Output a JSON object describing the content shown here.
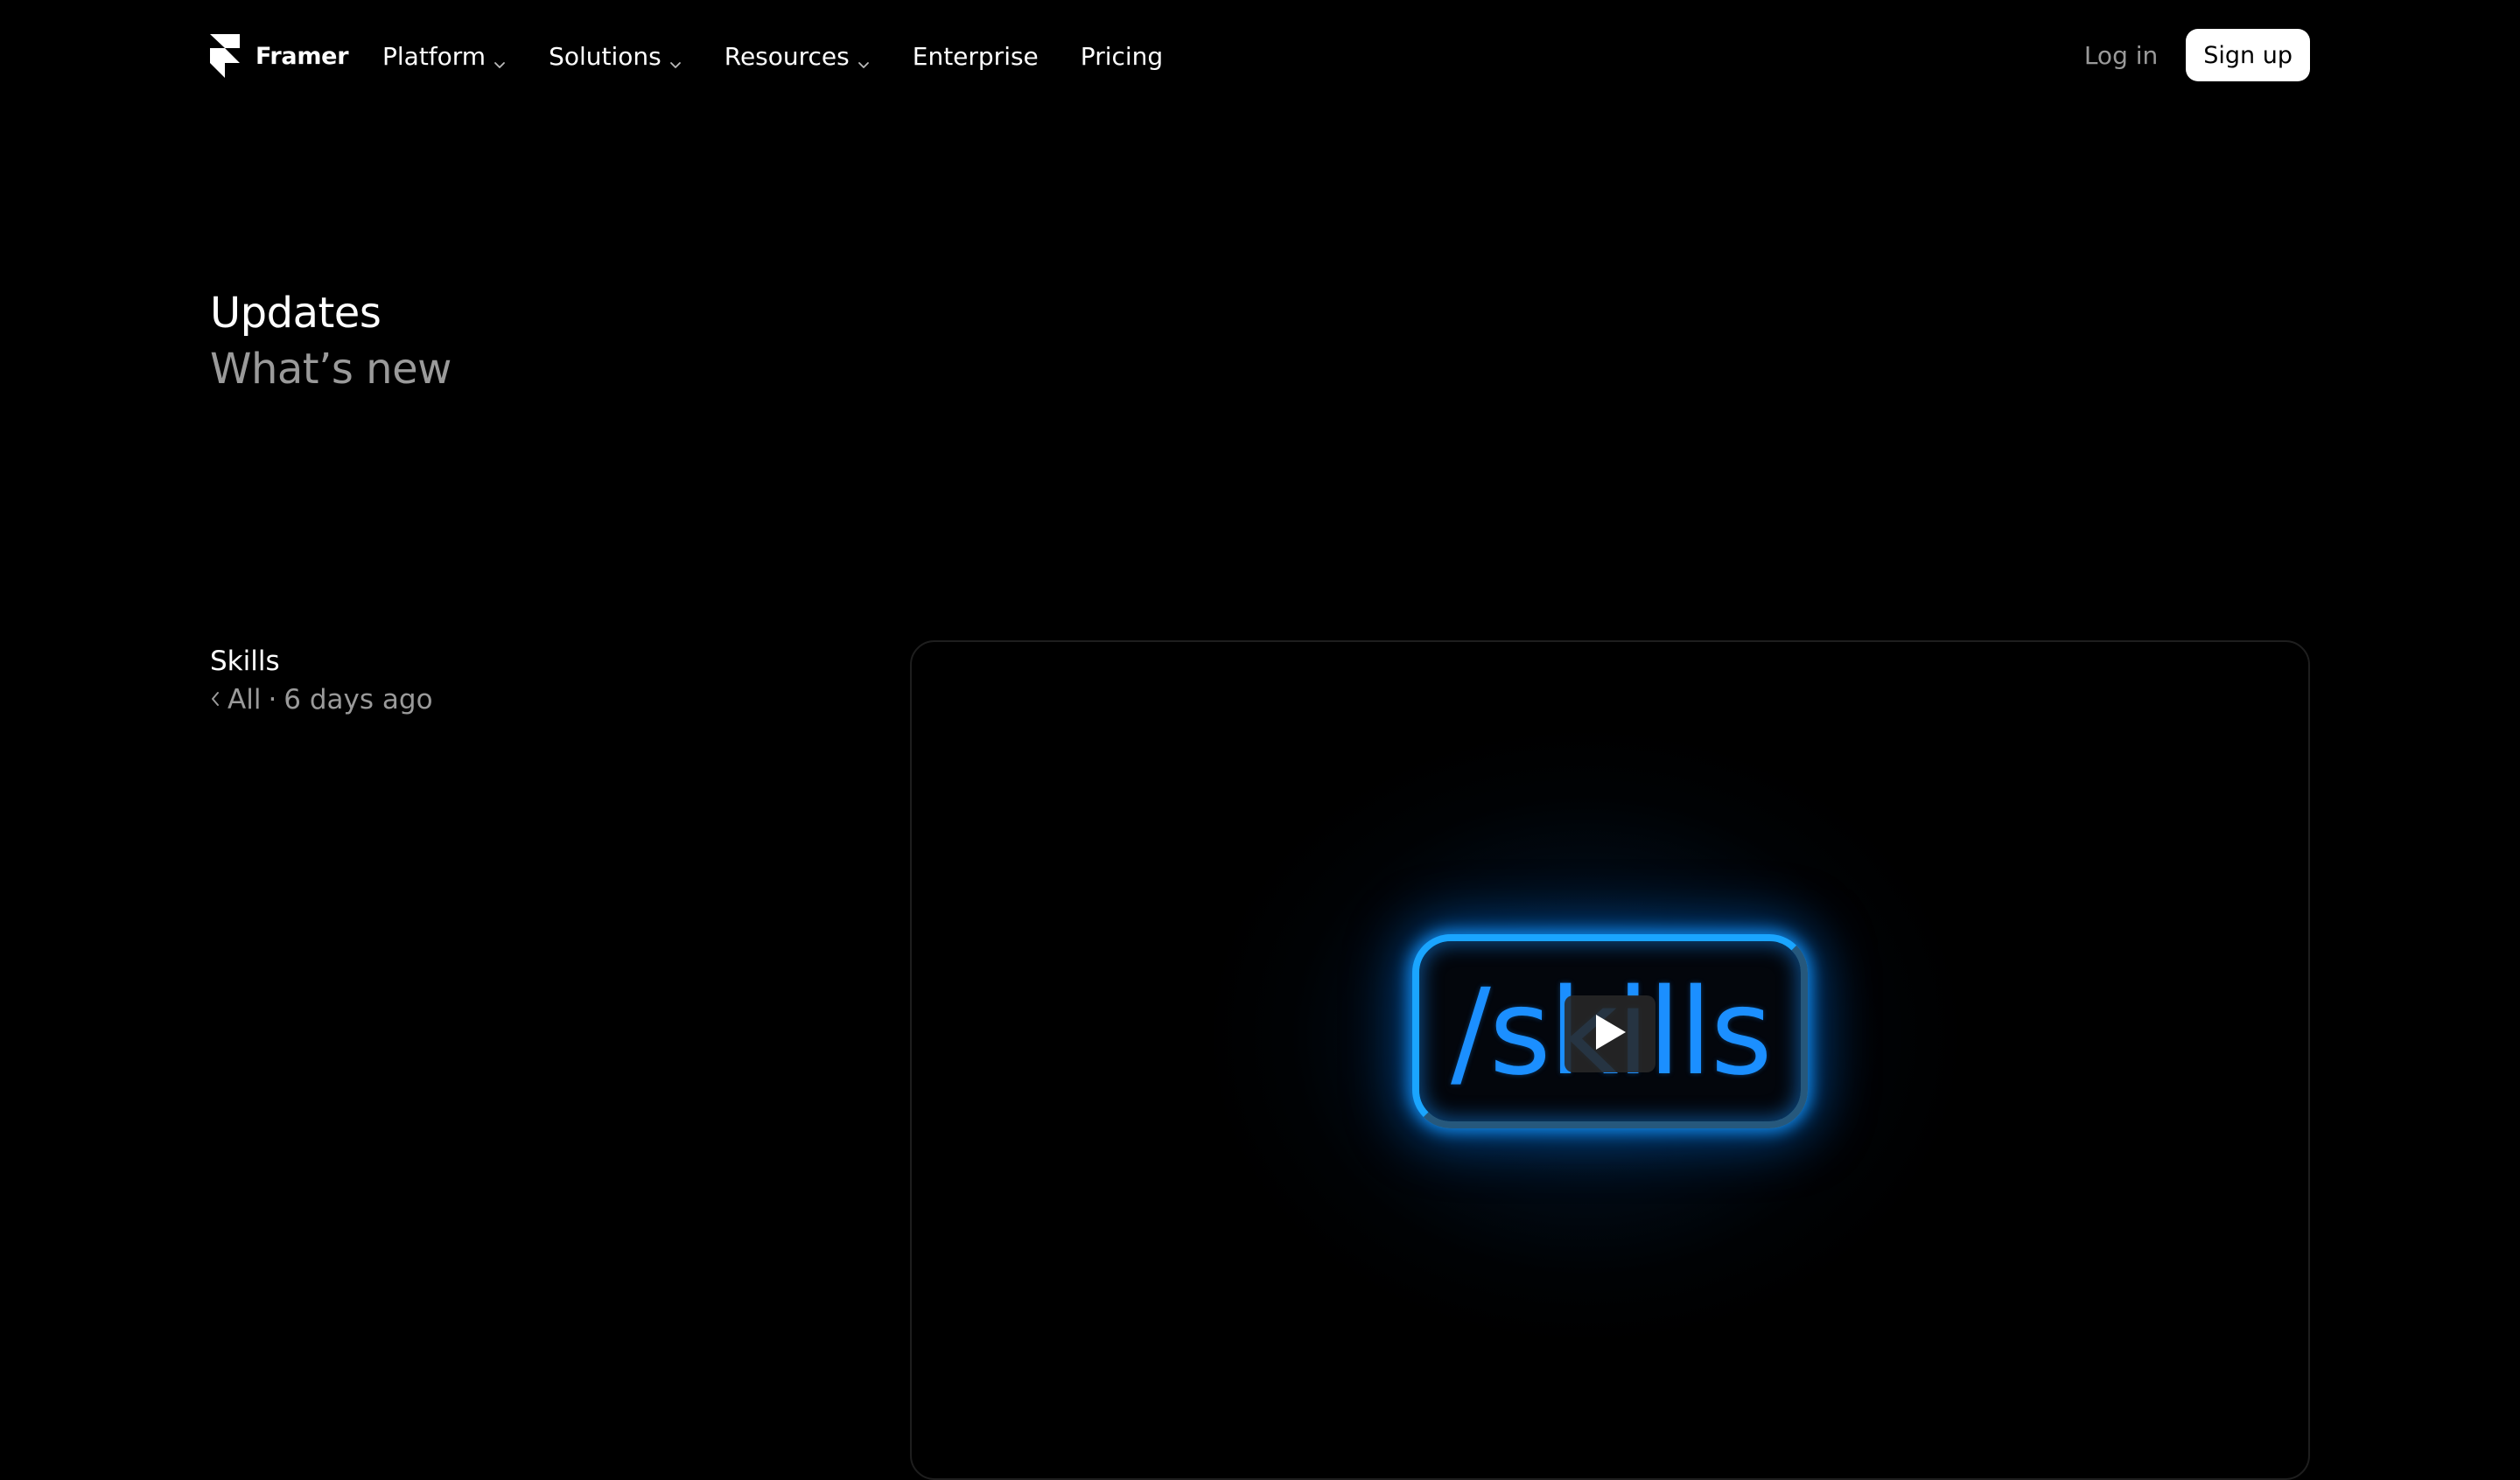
{
  "nav": {
    "brand": "Framer",
    "links": [
      {
        "label": "Platform",
        "has_dropdown": true
      },
      {
        "label": "Solutions",
        "has_dropdown": true
      },
      {
        "label": "Resources",
        "has_dropdown": true
      },
      {
        "label": "Enterprise",
        "has_dropdown": false
      },
      {
        "label": "Pricing",
        "has_dropdown": false
      }
    ],
    "login_label": "Log in",
    "signup_label": "Sign up"
  },
  "hero": {
    "title": "Updates",
    "subtitle": "What’s new"
  },
  "post": {
    "title": "Skills",
    "back_label": "All",
    "separator": "·",
    "time": "6 days ago"
  },
  "media": {
    "overlay_text": "/skills",
    "play_icon": "play-icon"
  },
  "colors": {
    "background": "#000000",
    "text_primary": "#ffffff",
    "text_secondary": "#9a9a9a",
    "accent_glow": "#1aa5ff",
    "skills_text": "#1b8fff"
  }
}
